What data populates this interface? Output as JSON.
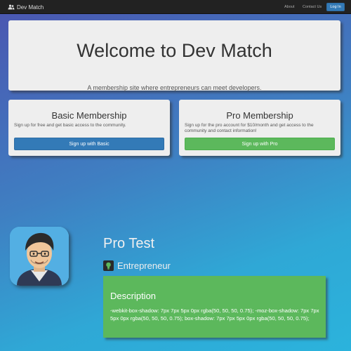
{
  "navbar": {
    "brand": "Dev Match",
    "links": [
      "About",
      "Contact Us"
    ],
    "login_label": "Log In"
  },
  "jumbotron": {
    "title": "Welcome to Dev Match",
    "subtitle": "A membership site where entrepreneurs can meet developers."
  },
  "plans": {
    "basic": {
      "title": "Basic Membership",
      "description": "Sign up for free and get basic access to the community.",
      "button": "Sign up with Basic"
    },
    "pro": {
      "title": "Pro Membership",
      "description": "Sign up for the pro account for $10/month and get access to the community and contact information!",
      "button": "Sign up with Pro"
    }
  },
  "profile": {
    "name": "Pro Test",
    "role": "Entrepreneur",
    "description_title": "Description",
    "description_text": "-webkit-box-shadow: 7px 7px 5px 0px rgba(50, 50, 50, 0.75); -moz-box-shadow: 7px 7px 5px 0px rgba(50, 50, 50, 0.75); box-shadow: 7px 7px 5px 0px rgba(50, 50, 50, 0.75);"
  },
  "colors": {
    "primary": "#337ab7",
    "success": "#5cb85c",
    "navbar": "#222222"
  }
}
